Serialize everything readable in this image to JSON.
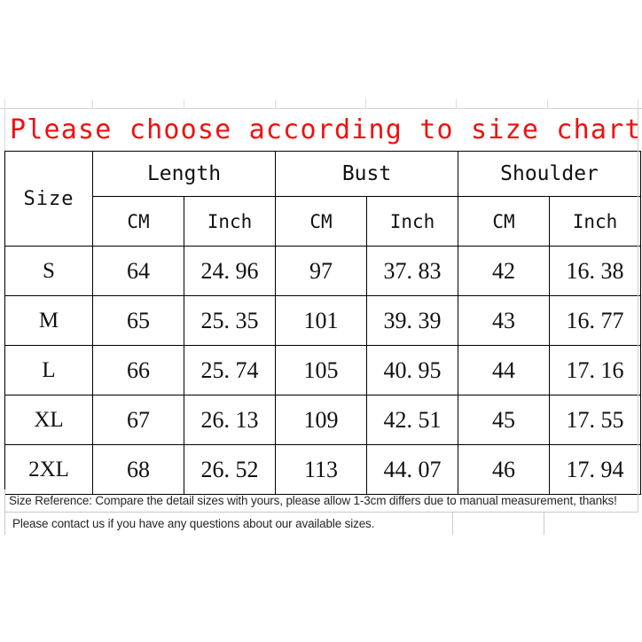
{
  "title": {
    "text": "Please choose according to size chart",
    "color": "#ee1111"
  },
  "table": {
    "group_headers": {
      "size": "Size",
      "length": "Length",
      "bust": "Bust",
      "shoulder": "Shoulder"
    },
    "unit_headers": {
      "length_cm": "CM",
      "length_inch": "Inch",
      "bust_cm": "CM",
      "bust_inch": "Inch",
      "shoulder_cm": "CM",
      "shoulder_inch": "Inch"
    },
    "rows": [
      {
        "size": "S",
        "length_cm": "64",
        "length_inch": "24. 96",
        "bust_cm": "97",
        "bust_inch": "37. 83",
        "shoulder_cm": "42",
        "shoulder_inch": "16. 38"
      },
      {
        "size": "M",
        "length_cm": "65",
        "length_inch": "25. 35",
        "bust_cm": "101",
        "bust_inch": "39. 39",
        "shoulder_cm": "43",
        "shoulder_inch": "16. 77"
      },
      {
        "size": "L",
        "length_cm": "66",
        "length_inch": "25. 74",
        "bust_cm": "105",
        "bust_inch": "40. 95",
        "shoulder_cm": "44",
        "shoulder_inch": "17. 16"
      },
      {
        "size": "XL",
        "length_cm": "67",
        "length_inch": "26. 13",
        "bust_cm": "109",
        "bust_inch": "42. 51",
        "shoulder_cm": "45",
        "shoulder_inch": "17. 55"
      },
      {
        "size": "2XL",
        "length_cm": "68",
        "length_inch": "26. 52",
        "bust_cm": "113",
        "bust_inch": "44. 07",
        "shoulder_cm": "46",
        "shoulder_inch": "17. 94"
      }
    ]
  },
  "footer": {
    "note_1": "Size Reference: Compare the detail sizes with yours, please allow 1-3cm differs due to manual measurement, thanks!",
    "note_2": "Please contact us if you have any questions about our available sizes."
  }
}
